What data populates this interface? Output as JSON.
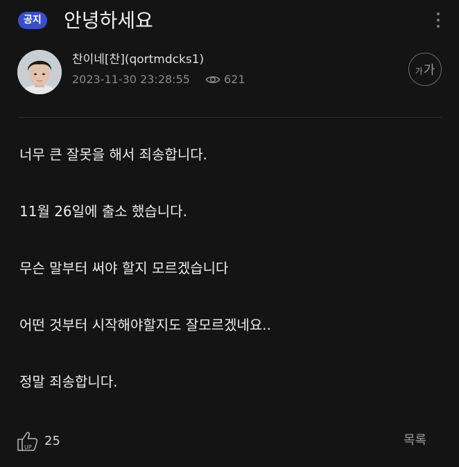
{
  "header": {
    "badge": "공지",
    "title": "안녕하세요"
  },
  "author": {
    "name": "찬이네[찬](qortmdcks1)",
    "date": "2023-11-30 23:28:55",
    "views": "621"
  },
  "font_button": {
    "small": "가",
    "large": "가"
  },
  "post": {
    "lines": [
      "너무 큰 잘못을 해서 죄송합니다.",
      "11월 26일에 출소 했습니다.",
      "무슨 말부터 써야 할지 모르겠습니다",
      "어떤 것부터 시작해야할지도 잘모르겠네요..",
      "정말 죄송합니다."
    ]
  },
  "footer": {
    "like_count": "25",
    "list_label": "목록"
  },
  "colors": {
    "background": "#141414",
    "badge": "#3a4fc4",
    "text": "#ececec",
    "muted": "#8a8a8a"
  },
  "icons": [
    "more-vertical-icon",
    "eye-icon",
    "thumbs-up-icon"
  ]
}
